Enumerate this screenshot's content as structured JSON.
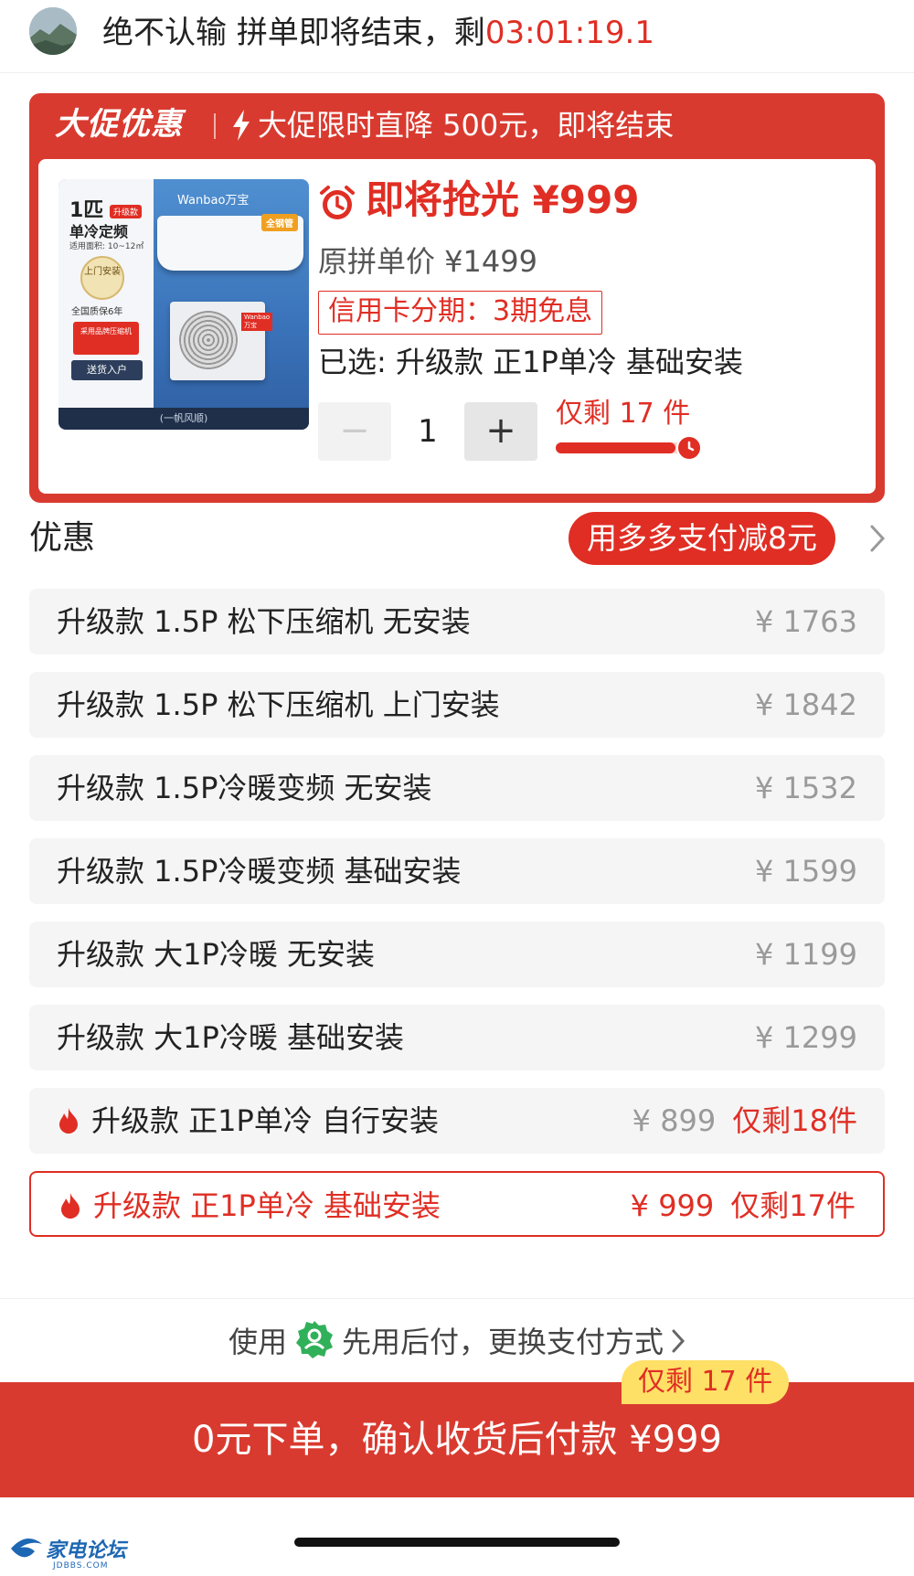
{
  "header": {
    "user_name": "绝不认输",
    "message": "拼单即将结束，剩",
    "countdown": "03:01:19.1"
  },
  "promo": {
    "brand": "大促优惠",
    "text": "大促限时直降 500元，即将结束",
    "image": {
      "size": "1匹",
      "upgrade_tag": "升级款",
      "type": "单冷定频",
      "area": "适用面积: 10~12㎡",
      "badge": "上门安装",
      "warranty": "全国质保6年",
      "compressor": "采用品牌压缩机",
      "delivery": "送货入户",
      "logo": "Wanbao万宝",
      "tag": "全钢管",
      "footer": "(一帆风顺)"
    },
    "urgent_label": "即将抢光 ¥999",
    "original_price": "原拼单价 ¥1499",
    "credit": "信用卡分期：3期免息",
    "selected": "已选: 升级款 正1P单冷  基础安装",
    "quantity": "1",
    "stock_text": "仅剩 17 件",
    "stock_progress": 0.9
  },
  "discount": {
    "label": "优惠",
    "pill": "用多多支付减8元"
  },
  "options": [
    {
      "label": "升级款 1.5P 松下压缩机 无安装",
      "price": "¥ 1763",
      "stock": "",
      "hot": false,
      "selected": false
    },
    {
      "label": "升级款 1.5P 松下压缩机 上门安装",
      "price": "¥ 1842",
      "stock": "",
      "hot": false,
      "selected": false
    },
    {
      "label": "升级款 1.5P冷暖变频 无安装",
      "price": "¥ 1532",
      "stock": "",
      "hot": false,
      "selected": false
    },
    {
      "label": "升级款 1.5P冷暖变频  基础安装",
      "price": "¥ 1599",
      "stock": "",
      "hot": false,
      "selected": false
    },
    {
      "label": "升级款 大1P冷暖  无安装",
      "price": "¥ 1199",
      "stock": "",
      "hot": false,
      "selected": false
    },
    {
      "label": "升级款 大1P冷暖  基础安装",
      "price": "¥ 1299",
      "stock": "",
      "hot": false,
      "selected": false
    },
    {
      "label": "升级款 正1P单冷  自行安装",
      "price": "¥ 899",
      "stock": "仅剩18件",
      "hot": true,
      "selected": false
    },
    {
      "label": "升级款 正1P单冷  基础安装",
      "price": "¥ 999",
      "stock": "仅剩17件",
      "hot": true,
      "selected": true
    }
  ],
  "payment": {
    "prefix": "使用",
    "method": "先用后付，更换支付方式"
  },
  "cta": {
    "label": "0元下单，确认收货后付款 ¥999",
    "bubble": "仅剩 17 件"
  },
  "watermark": {
    "text": "家电论坛",
    "sub": "JDBBS.COM"
  },
  "colors": {
    "accent": "#e02e24",
    "promo_bg": "#d93a2f",
    "option_bg": "#f5f5f5",
    "bubble": "#ffe066"
  }
}
